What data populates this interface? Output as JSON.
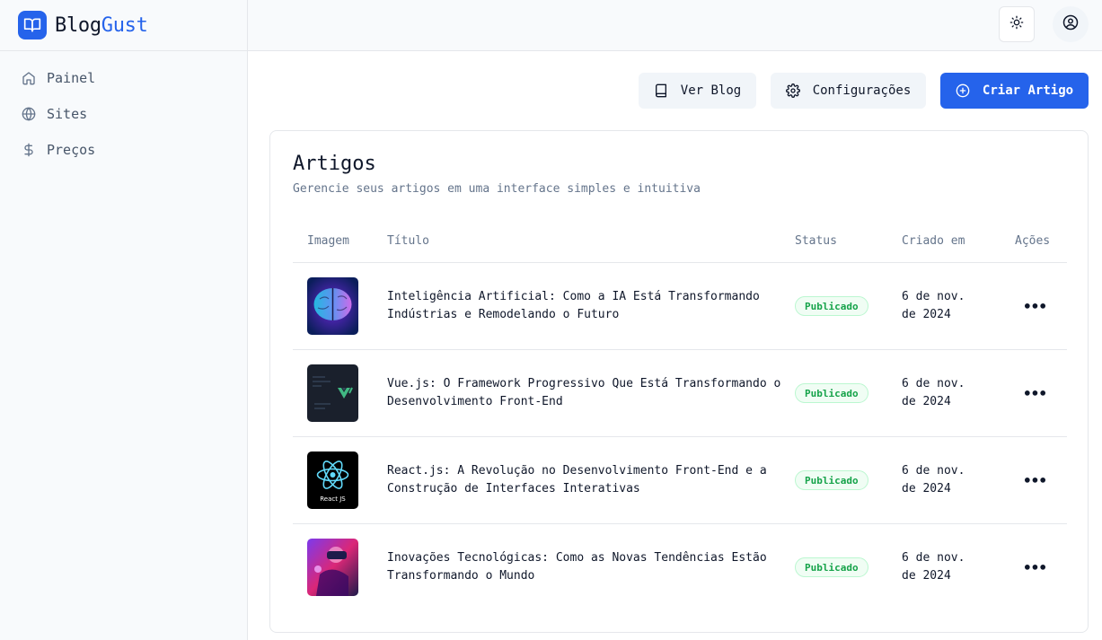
{
  "brand": {
    "part1": "Blog",
    "part2": "Gust",
    "icon": "book-open-icon"
  },
  "sidebar": {
    "items": [
      {
        "label": "Painel",
        "icon": "home-icon"
      },
      {
        "label": "Sites",
        "icon": "globe-icon"
      },
      {
        "label": "Preços",
        "icon": "dollar-icon"
      }
    ]
  },
  "topbar": {
    "theme_icon": "sun-icon",
    "user_icon": "user-circle-icon"
  },
  "actions": {
    "view_blog": "Ver Blog",
    "settings": "Configurações",
    "create": "Criar Artigo"
  },
  "card": {
    "title": "Artigos",
    "subtitle": "Gerencie seus artigos em uma interface simples e intuitiva",
    "columns": [
      "Imagem",
      "Título",
      "Status",
      "Criado em",
      "Ações"
    ]
  },
  "articles": [
    {
      "title": "Inteligência Artificial: Como a IA Está Transformando Indústrias e Remodelando o Futuro",
      "status": "Publicado",
      "created": "6 de nov. de 2024",
      "thumb": "ai-brain-image"
    },
    {
      "title": "Vue.js: O Framework Progressivo Que Está Transformando o Desenvolvimento Front-End",
      "status": "Publicado",
      "created": "6 de nov. de 2024",
      "thumb": "vue-logo-image"
    },
    {
      "title": "React.js: A Revolução no Desenvolvimento Front-End e a Construção de Interfaces Interativas",
      "status": "Publicado",
      "created": "6 de nov. de 2024",
      "thumb": "react-logo-image",
      "thumb_caption": "React JS"
    },
    {
      "title": "Inovações Tecnológicas: Como as Novas Tendências Estão Transformando o Mundo",
      "status": "Publicado",
      "created": "6 de nov. de 2024",
      "thumb": "vr-headset-image"
    }
  ],
  "colors": {
    "accent": "#2563eb",
    "status_green": "#16a34a"
  }
}
